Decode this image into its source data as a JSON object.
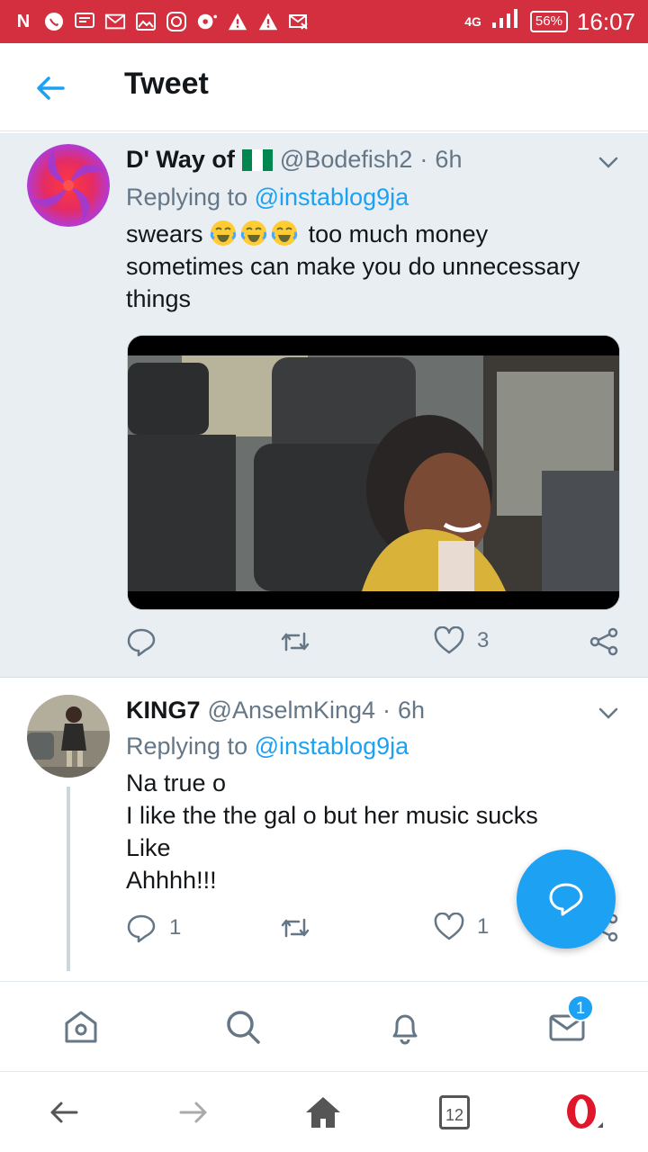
{
  "status_bar": {
    "icons": [
      "N",
      "whatsapp",
      "message",
      "gmail",
      "gallery",
      "instagram",
      "opera-max",
      "warning",
      "warning",
      "email-off"
    ],
    "network": "4G",
    "battery": "56%",
    "time": "16:07"
  },
  "header": {
    "title": "Tweet"
  },
  "tweets": [
    {
      "display_name": "D' Way of",
      "handle": "@Bodefish2",
      "separator": "·",
      "time": "6h",
      "replying_prefix": "Replying to",
      "replying_to": "@instablog9ja",
      "text_before_emoji": "swears",
      "emoji": "😂😂😂",
      "text_after_emoji": "too much money sometimes can make you do unnecessary things",
      "has_media": true,
      "reply_count": "",
      "retweet_count": "",
      "like_count": "3"
    },
    {
      "display_name": "KING7",
      "handle": "@AnselmKing4",
      "separator": "·",
      "time": "6h",
      "replying_prefix": "Replying to",
      "replying_to": "@instablog9ja",
      "lines": [
        "Na true o",
        "I like the the gal o but her music sucks",
        "Like",
        "Ahhhh!!!"
      ],
      "reply_count": "1",
      "retweet_count": "",
      "like_count": "1"
    }
  ],
  "tabbar": {
    "notification_badge": "1",
    "tabs": [
      "home",
      "search",
      "notifications",
      "messages"
    ]
  },
  "browser_nav": {
    "tab_count": "12"
  },
  "colors": {
    "status_bar": "#d32f3f",
    "accent": "#1da1f2",
    "selected_bg": "#e8eef2"
  }
}
